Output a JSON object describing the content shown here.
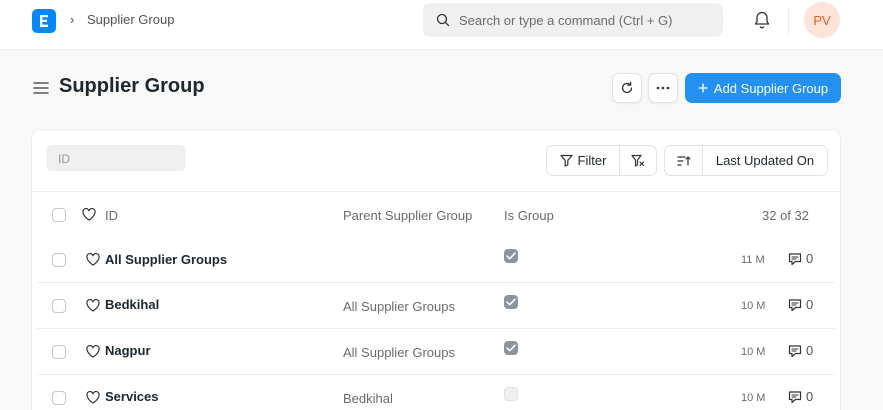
{
  "navbar": {
    "breadcrumb_sep": "›",
    "breadcrumb": "Supplier Group",
    "search_placeholder": "Search or type a command (Ctrl + G)",
    "avatar_initials": "PV"
  },
  "page": {
    "title": "Supplier Group",
    "add_button": "Add Supplier Group"
  },
  "toolbar": {
    "id_placeholder": "ID",
    "filter_label": "Filter",
    "sort_label": "Last Updated On"
  },
  "list": {
    "headers": {
      "id": "ID",
      "parent": "Parent Supplier Group",
      "is_group": "Is Group",
      "count": "32 of 32"
    },
    "rows": [
      {
        "id": "All Supplier Groups",
        "parent": "",
        "is_group": true,
        "modified": "11 M",
        "comments": "0"
      },
      {
        "id": "Bedkihal",
        "parent": "All Supplier Groups",
        "is_group": true,
        "modified": "10 M",
        "comments": "0"
      },
      {
        "id": "Nagpur",
        "parent": "All Supplier Groups",
        "is_group": true,
        "modified": "10 M",
        "comments": "0"
      },
      {
        "id": "Services",
        "parent": "Bedkihal",
        "is_group": false,
        "modified": "10 M",
        "comments": "0"
      }
    ]
  },
  "colors": {
    "primary": "#2490ef",
    "logo": "#0289f7",
    "avatar_bg": "#fde3d8",
    "avatar_text": "#e0622c"
  }
}
